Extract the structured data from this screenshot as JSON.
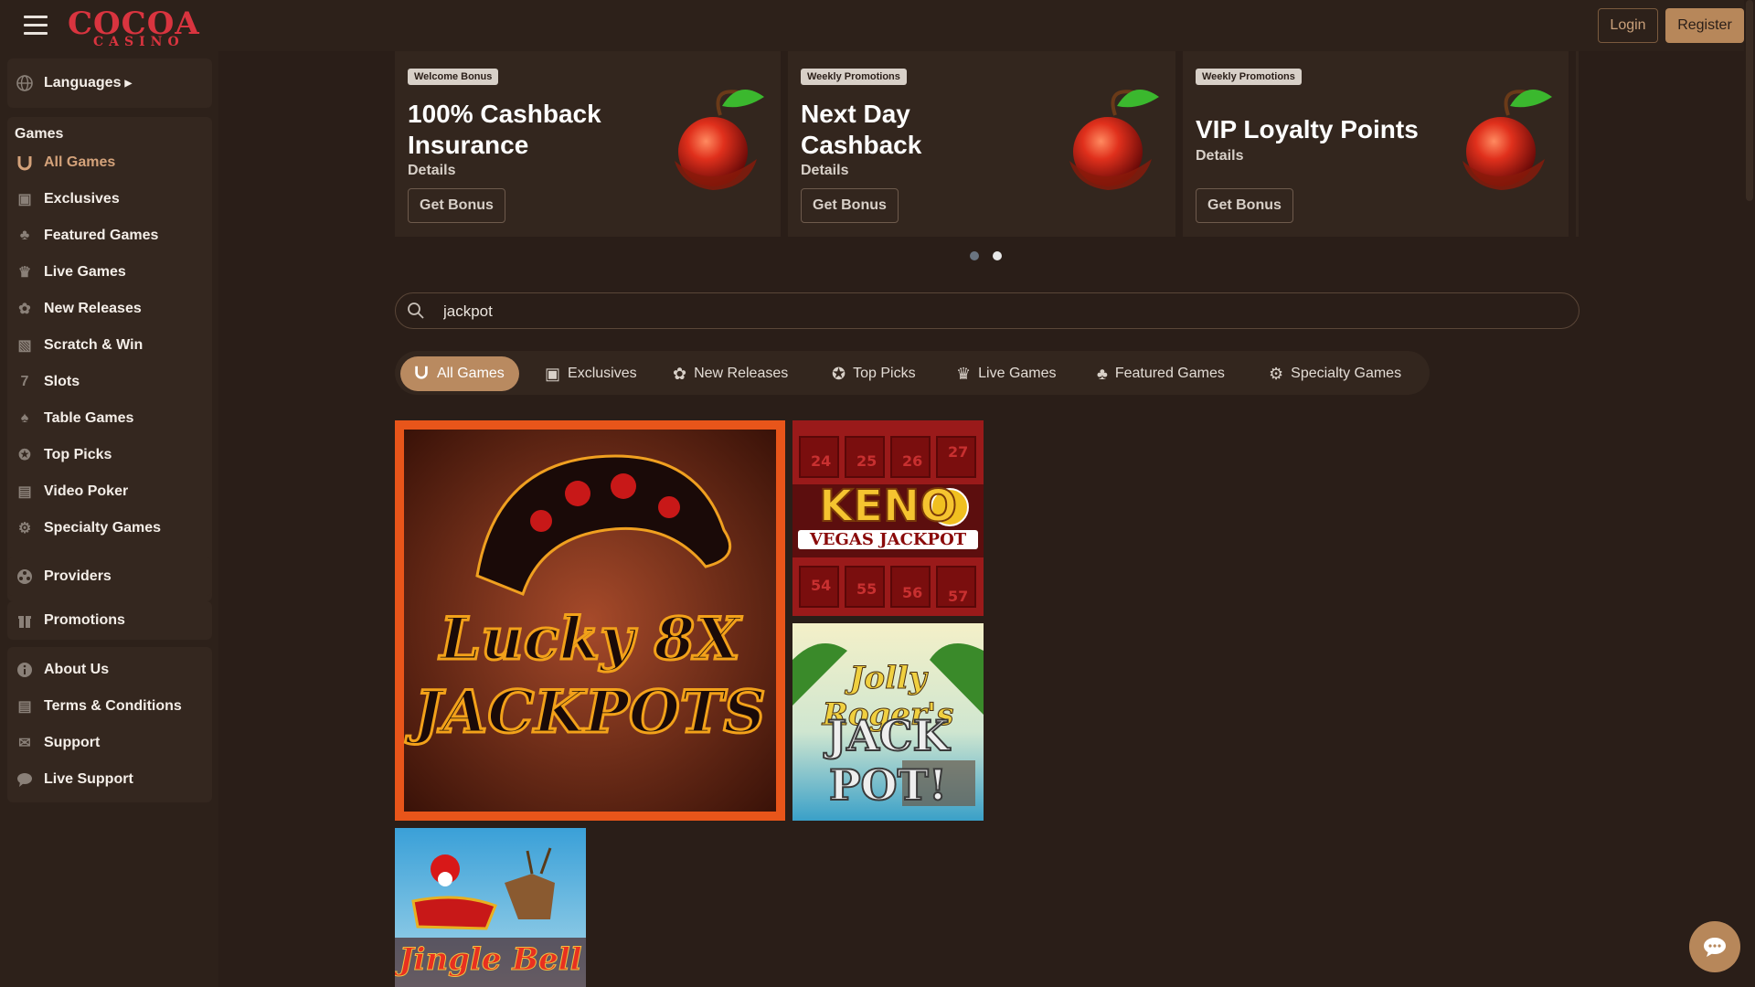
{
  "header": {
    "logo_word": "COCOA",
    "logo_sub": "CASINO",
    "login_label": "Login",
    "register_label": "Register"
  },
  "sidebar": {
    "languages": "Languages",
    "games_heading": "Games",
    "games": [
      {
        "label": "All Games",
        "icon": "horseshoe-icon"
      },
      {
        "label": "Exclusives",
        "icon": "exclusive-icon"
      },
      {
        "label": "Featured Games",
        "icon": "clover-icon"
      },
      {
        "label": "Live Games",
        "icon": "live-dealer-icon"
      },
      {
        "label": "New Releases",
        "icon": "new-icon"
      },
      {
        "label": "Scratch & Win",
        "icon": "scratch-card-icon"
      },
      {
        "label": "Slots",
        "icon": "slot-machine-icon"
      },
      {
        "label": "Table Games",
        "icon": "cards-icon"
      },
      {
        "label": "Top Picks",
        "icon": "award-icon"
      },
      {
        "label": "Video Poker",
        "icon": "video-poker-icon"
      },
      {
        "label": "Specialty Games",
        "icon": "gear-icon"
      }
    ],
    "providers": "Providers",
    "promotions": "Promotions",
    "info": [
      {
        "label": "About Us",
        "icon": "info-icon"
      },
      {
        "label": "Terms & Conditions",
        "icon": "document-icon"
      },
      {
        "label": "Support",
        "icon": "mail-icon"
      },
      {
        "label": "Live Support",
        "icon": "chat-icon"
      }
    ]
  },
  "promos": [
    {
      "badge": "Welcome Bonus",
      "title": "100% Cashback Insurance",
      "details": "Details",
      "button": "Get Bonus"
    },
    {
      "badge": "Weekly Promotions",
      "title": "Next Day Cashback",
      "details": "Details",
      "button": "Get Bonus"
    },
    {
      "badge": "Weekly Promotions",
      "title": "VIP Loyalty Points",
      "details": "Details",
      "button": "Get Bonus"
    }
  ],
  "carousel": {
    "pages": 2,
    "active_page": 2
  },
  "search": {
    "value": "jackpot"
  },
  "tabs": [
    {
      "label": "All Games",
      "icon": "horseshoe-icon",
      "active": true
    },
    {
      "label": "Exclusives",
      "icon": "exclusive-icon",
      "active": false
    },
    {
      "label": "New Releases",
      "icon": "new-icon",
      "active": false
    },
    {
      "label": "Top Picks",
      "icon": "award-icon",
      "active": false
    },
    {
      "label": "Live Games",
      "icon": "live-dealer-icon",
      "active": false
    },
    {
      "label": "Featured Games",
      "icon": "clover-icon",
      "active": false
    },
    {
      "label": "Specialty Games",
      "icon": "gear-icon",
      "active": false
    }
  ],
  "games": [
    {
      "title_lines": [
        "Lucky 8X",
        "JACKPOTS"
      ]
    },
    {
      "title_lines": [
        "KENO",
        "VEGAS JACKPOT"
      ]
    },
    {
      "title_lines": [
        "Jolly Roger's",
        "JACK POT!"
      ]
    },
    {
      "title_lines": [
        "Jingle Bell"
      ]
    }
  ],
  "colors": {
    "accent": "#b7875a",
    "background": "#2a1e18",
    "panel": "#33261e"
  }
}
